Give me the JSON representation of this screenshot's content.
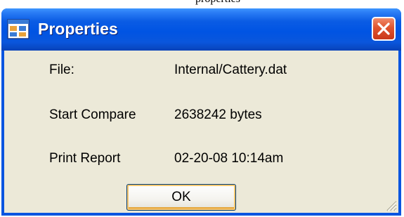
{
  "page_caption": "properties",
  "window": {
    "title": "Properties",
    "icons": {
      "app": "properties-window-icon",
      "close": "close-icon",
      "grip": "resize-grip-icon"
    },
    "colors": {
      "titlebar": "#0054e3",
      "client": "#ece9d8",
      "close_button": "#e0542e"
    }
  },
  "fields": [
    {
      "label": "File:",
      "value": "Internal/Cattery.dat"
    },
    {
      "label": "Start Compare",
      "value": "2638242 bytes"
    },
    {
      "label": "Print Report",
      "value": "02-20-08 10:14am"
    }
  ],
  "buttons": {
    "ok": "OK"
  }
}
